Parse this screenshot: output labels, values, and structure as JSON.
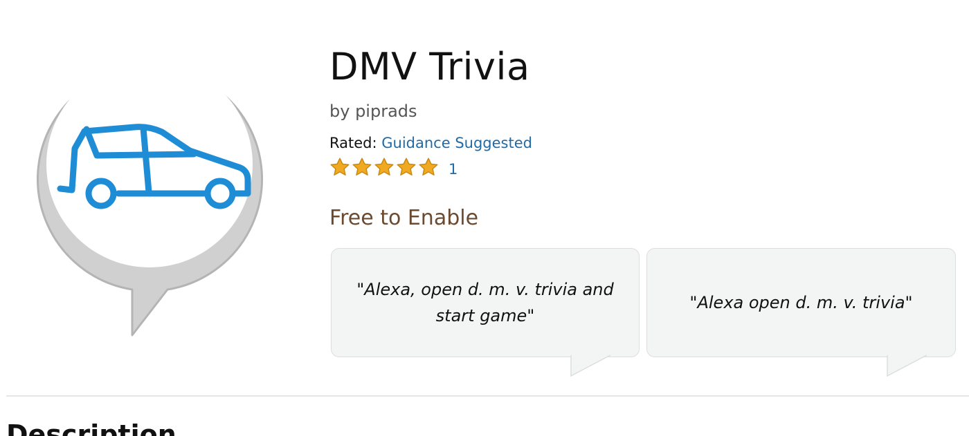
{
  "skill": {
    "title": "DMV Trivia",
    "byline": "by piprads",
    "icon": "car-icon",
    "rating_label": "Rated:",
    "rating_value": "Guidance Suggested",
    "stars": 5,
    "review_count": "1",
    "price": "Free to Enable"
  },
  "phrases": [
    "\"Alexa, open d. m. v. trivia and start game\"",
    "\"Alexa open d. m. v. trivia\""
  ],
  "sections": {
    "description_heading": "Description"
  },
  "colors": {
    "icon_blue": "#1f8dd6",
    "link_blue": "#1f6aa8",
    "star_gold": "#f0a920",
    "price_brown": "#6b4a2f",
    "bubble_bg": "#f3f4f4"
  }
}
